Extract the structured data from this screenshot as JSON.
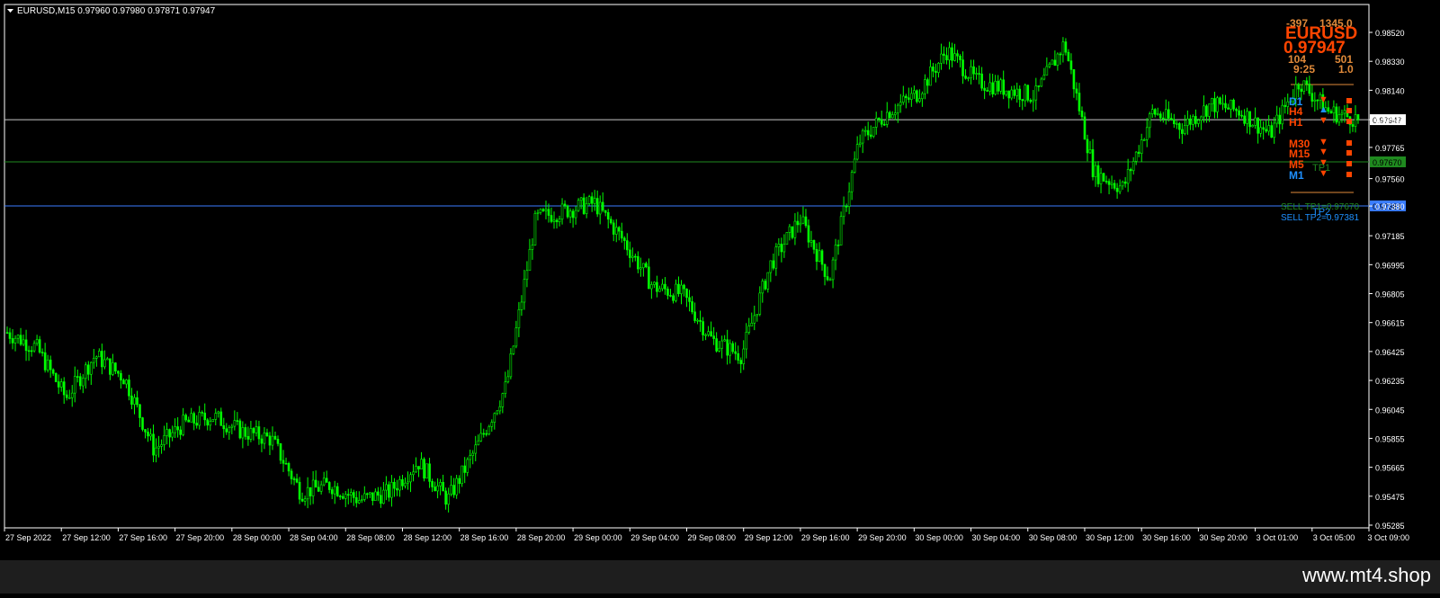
{
  "chart": {
    "symbol_header": "EURUSD,M15  0.97960 0.97980 0.97871 0.97947",
    "background": "#000000",
    "candle_color": "#00ff00",
    "foreground": "#ffffff"
  },
  "price_axis": {
    "ticks": [
      "0.98520",
      "0.98330",
      "0.98140",
      "0.97947",
      "0.97765",
      "0.97560",
      "0.97380",
      "0.97185",
      "0.96995",
      "0.96805",
      "0.96615",
      "0.96425",
      "0.96235",
      "0.96045",
      "0.95855",
      "0.95665",
      "0.95475",
      "0.95285"
    ]
  },
  "time_axis": {
    "ticks": [
      "27 Sep 2022",
      "27 Sep 12:00",
      "27 Sep 16:00",
      "27 Sep 20:00",
      "28 Sep 00:00",
      "28 Sep 04:00",
      "28 Sep 08:00",
      "28 Sep 12:00",
      "28 Sep 16:00",
      "28 Sep 20:00",
      "29 Sep 00:00",
      "29 Sep 04:00",
      "29 Sep 08:00",
      "29 Sep 12:00",
      "29 Sep 16:00",
      "29 Sep 20:00",
      "30 Sep 00:00",
      "30 Sep 04:00",
      "30 Sep 08:00",
      "30 Sep 12:00",
      "30 Sep 16:00",
      "30 Sep 20:00",
      "3 Oct 01:00",
      "3 Oct 05:00",
      "3 Oct 09:00"
    ]
  },
  "levels": [
    {
      "price": "0.97947",
      "color": "#c8c8c8",
      "label_bg": "#ffffff",
      "label_color": "#000000"
    },
    {
      "price": "0.97670",
      "color": "#1f8a1f",
      "label_bg": "#1f8a1f",
      "label_color": "#000000"
    },
    {
      "price": "0.97381",
      "color": "#3a7cff",
      "label_bg": "#3a7cff",
      "label_color": "#000000"
    }
  ],
  "indicator": {
    "left_num": "-397",
    "right_num": "1345.0",
    "symbol": "EURUSD",
    "price": "0.97947",
    "sub_left": "104",
    "sub_right": "501",
    "time_left": "9:25",
    "time_right": "1.0",
    "tp_marker_1": "TP1",
    "tp_marker_2": "TP2",
    "sell_tp1": "SELL TP1=0.97670",
    "sell_tp2": "SELL TP2=0.97381",
    "accent": "#ff4500",
    "secondary": "#e08a3a",
    "blue": "#1e90ff",
    "timeframes": [
      {
        "label": "D1",
        "color": "#1e90ff",
        "arrow": "▼",
        "arrow_color": "#ff4500",
        "square_color": "#ff4500"
      },
      {
        "label": "H4",
        "color": "#ff4500",
        "arrow": "▲",
        "arrow_color": "#1e90ff",
        "square_color": "#ff4500"
      },
      {
        "label": "H1",
        "color": "#ff4500",
        "arrow": "▼",
        "arrow_color": "#ff4500",
        "square_color": "#ff4500"
      },
      {
        "label": "M30",
        "color": "#ff4500",
        "arrow": "▼",
        "arrow_color": "#ff4500",
        "square_color": "#ff4500"
      },
      {
        "label": "M15",
        "color": "#ff4500",
        "arrow": "▼",
        "arrow_color": "#ff4500",
        "square_color": "#ff4500"
      },
      {
        "label": "M5",
        "color": "#ff4500",
        "arrow": "▼",
        "arrow_color": "#ff4500",
        "square_color": "#ff4500"
      },
      {
        "label": "M1",
        "color": "#1e90ff",
        "arrow": "▼",
        "arrow_color": "#ff4500",
        "square_color": "#ff4500"
      }
    ]
  },
  "footer": {
    "watermark": "www.mt4.shop"
  },
  "chart_data": {
    "type": "candlestick",
    "title": "EURUSD,M15",
    "ylim": [
      0.9526,
      0.9862
    ],
    "x": [
      "27 Sep 2022",
      "27 Sep 12:00",
      "27 Sep 16:00",
      "27 Sep 20:00",
      "28 Sep 00:00",
      "28 Sep 04:00",
      "28 Sep 08:00",
      "28 Sep 12:00",
      "28 Sep 16:00",
      "28 Sep 20:00",
      "29 Sep 00:00",
      "29 Sep 04:00",
      "29 Sep 08:00",
      "29 Sep 12:00",
      "29 Sep 16:00",
      "29 Sep 20:00",
      "30 Sep 00:00",
      "30 Sep 04:00",
      "30 Sep 08:00",
      "30 Sep 12:00",
      "30 Sep 16:00",
      "30 Sep 20:00",
      "3 Oct 01:00",
      "3 Oct 05:00",
      "3 Oct 09:00"
    ],
    "close_path": [
      0.9655,
      0.9645,
      0.9612,
      0.964,
      0.9625,
      0.9578,
      0.9595,
      0.96,
      0.959,
      0.9585,
      0.955,
      0.9555,
      0.9545,
      0.955,
      0.957,
      0.9545,
      0.958,
      0.962,
      0.973,
      0.9735,
      0.974,
      0.9715,
      0.9685,
      0.968,
      0.965,
      0.964,
      0.97,
      0.973,
      0.969,
      0.978,
      0.98,
      0.9812,
      0.984,
      0.982,
      0.9815,
      0.981,
      0.9845,
      0.976,
      0.975,
      0.98,
      0.979,
      0.9805,
      0.98,
      0.9785,
      0.982,
      0.98,
      0.9795
    ],
    "last_price": 0.97947
  }
}
